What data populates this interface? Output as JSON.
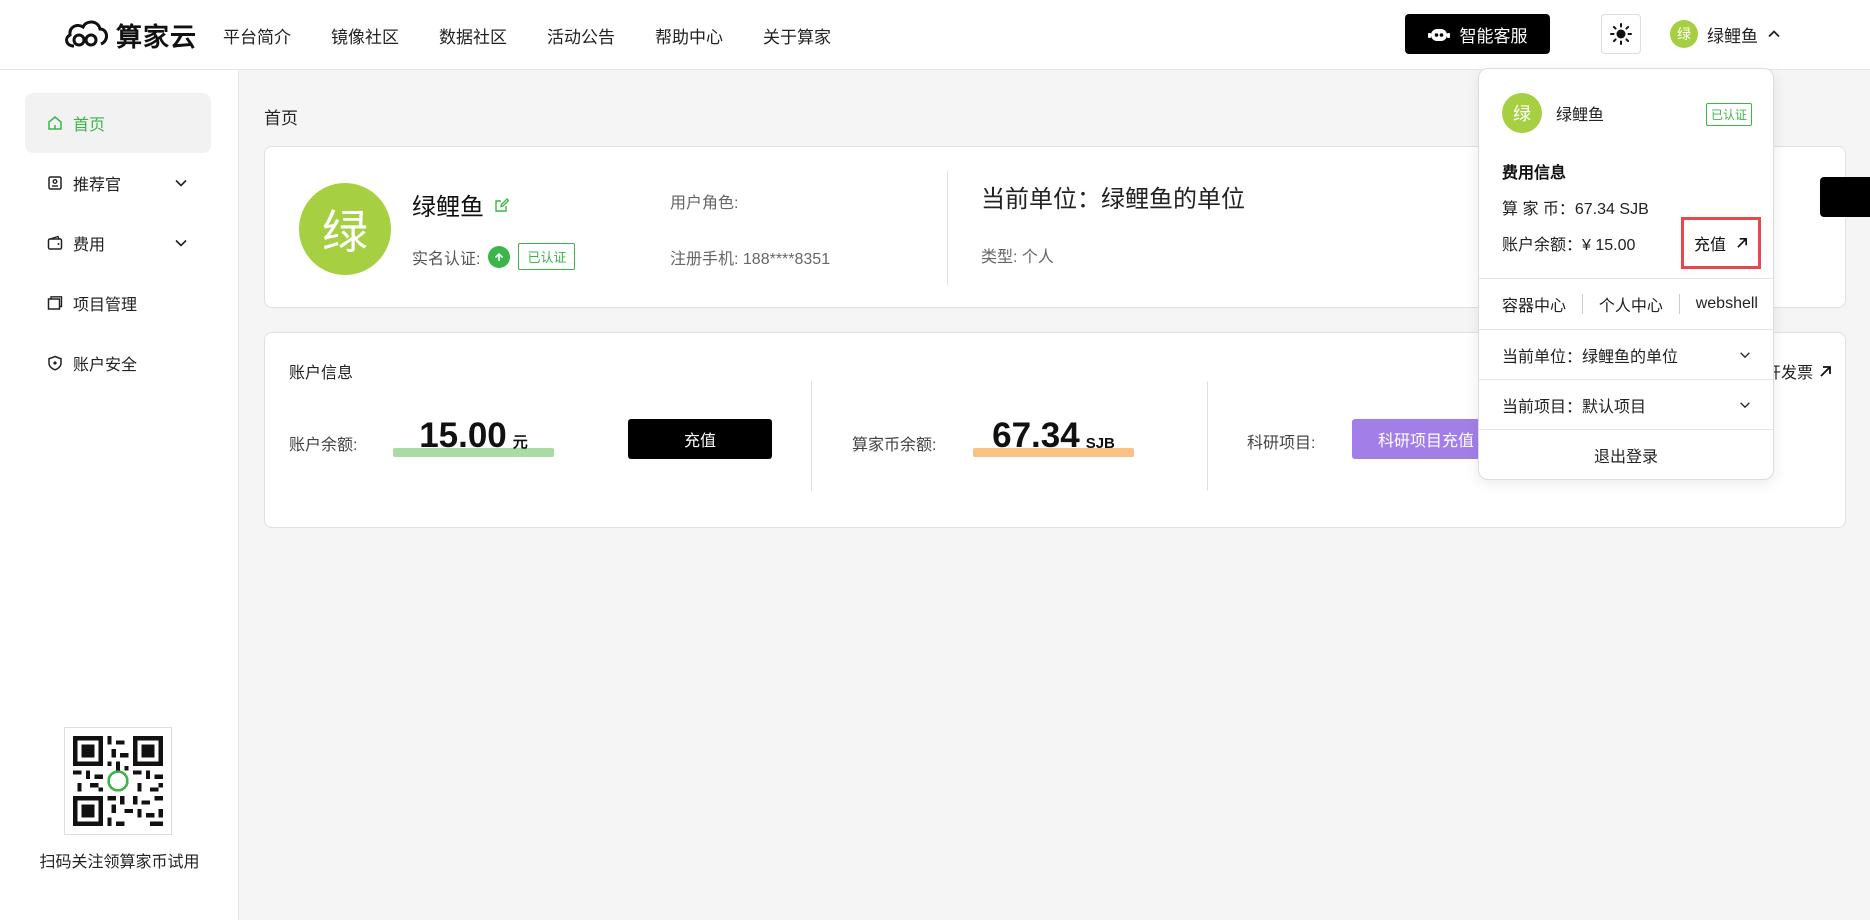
{
  "header": {
    "brand": "算家云",
    "nav": [
      "平台简介",
      "镜像社区",
      "数据社区",
      "活动公告",
      "帮助中心",
      "关于算家"
    ],
    "service_label": "智能客服",
    "user_avatar_char": "绿",
    "user_name": "绿鲤鱼"
  },
  "sidebar": {
    "items": [
      {
        "label": "首页",
        "icon": "home-icon",
        "active": true
      },
      {
        "label": "推荐官",
        "icon": "badge-icon",
        "expandable": true
      },
      {
        "label": "费用",
        "icon": "wallet-icon",
        "expandable": true
      },
      {
        "label": "项目管理",
        "icon": "folder-icon"
      },
      {
        "label": "账户安全",
        "icon": "shield-icon"
      }
    ],
    "qr_caption": "扫码关注领算家币试用"
  },
  "main": {
    "breadcrumb": "首页",
    "profile": {
      "avatar_char": "绿",
      "name": "绿鲤鱼",
      "realname_label": "实名认证:",
      "verified_tag": "已认证",
      "role_label": "用户角色:",
      "phone_label": "注册手机:",
      "phone_value": "188****8351",
      "unit_title": "当前单位：绿鲤鱼的单位",
      "unit_type_label": "类型:",
      "unit_type_value": "个人"
    },
    "account": {
      "title": "账户信息",
      "invoice_partial": "开发票",
      "balance_label": "账户余额:",
      "balance_value": "15.00",
      "balance_unit": "元",
      "recharge_label": "充值",
      "coin_label": "算家币余额:",
      "coin_value": "67.34",
      "coin_unit": "SJB",
      "research_label": "科研项目:",
      "research_btn": "科研项目充值"
    }
  },
  "dropdown": {
    "avatar_char": "绿",
    "name": "绿鲤鱼",
    "verified_tag": "已认证",
    "fee_title": "费用信息",
    "coin_label": "算 家 币：",
    "coin_value": "67.34 SJB",
    "balance_label": "账户余额：",
    "balance_value": "¥ 15.00",
    "recharge_label": "充值",
    "links": [
      "容器中心",
      "个人中心",
      "webshell"
    ],
    "unit_label": "当前单位：绿鲤鱼的单位",
    "project_label": "当前项目：默认项目",
    "logout": "退出登录"
  },
  "colors": {
    "brand_green": "#3cb54a",
    "avatar_green": "#a6d041",
    "balance_highlight": "#a8dca4",
    "coin_highlight": "#f8c384",
    "research_purple": "#a27fe8",
    "highlight_box": "#e5484d"
  }
}
